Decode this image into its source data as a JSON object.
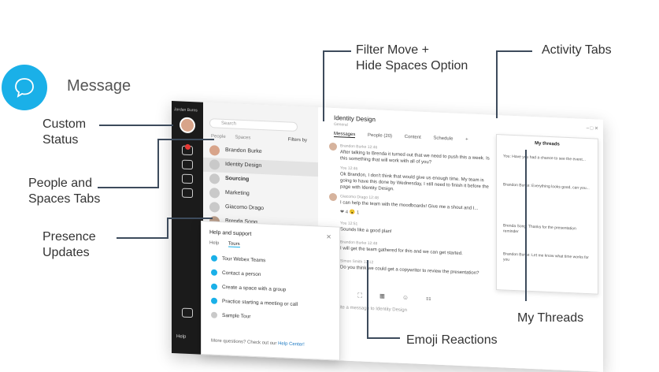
{
  "logo": {
    "label": "Message",
    "color": "#1ab0e8"
  },
  "callouts": {
    "filter": "Filter Move +\nHide Spaces Option",
    "activity_tabs": "Activity Tabs",
    "custom_status": "Custom\nStatus",
    "people_spaces": "People and\nSpaces Tabs",
    "presence": "Presence\nUpdates",
    "my_threads": "My Threads",
    "emoji": "Emoji Reactions"
  },
  "app": {
    "nav": {
      "user": "Jordan Burns",
      "help": "Help"
    },
    "search": {
      "placeholder": "Search"
    },
    "list_tabs": [
      "People",
      "Spaces"
    ],
    "filters": "Filters by",
    "spaces": [
      {
        "name": "Brandon Burke"
      },
      {
        "name": "Identity Design"
      },
      {
        "name": "Sourcing"
      },
      {
        "name": "Marketing"
      },
      {
        "name": "Giacomo Drago"
      },
      {
        "name": "Brenda Song"
      }
    ],
    "conversation": {
      "title": "Identity Design",
      "subtitle": "General",
      "tabs": [
        "Messages",
        "People (20)",
        "Content",
        "Schedule",
        "+"
      ],
      "messages": [
        {
          "who": "Brandon Burke 12:46",
          "text": "After talking to Brenda it turned out that we need to push this a week. Is this something that will work with all of you?"
        },
        {
          "who": "You 12:46",
          "text": "Ok Brandon, I don't think that would give us enough time. My team is going to have this done by Wednesday, I still need to finish it before the page with Identity Design."
        },
        {
          "who": "Giacomo Drago 12:48",
          "text": "I can help the team with the moodboards! Give me a shout and I..."
        },
        {
          "who": "You 12:51",
          "text": "Sounds like a good plan!"
        },
        {
          "who": "Brandon Burke 12:48",
          "text": "I will get the team gathered for this and we can get started."
        },
        {
          "who": "Simon Smith 13:12",
          "text": "Do you think we could get a copywriter to review the presentation?"
        }
      ],
      "reactions": "❤ 4  😮 1",
      "compose_icons": "☺ ⛶ ▦ ☺ ☷",
      "compose_placeholder": "Write a message to Identity Design"
    },
    "threads": {
      "title": "My threads",
      "items": [
        {
          "text": "You: Have you had a chance to see the event..."
        },
        {
          "text": "Brandon Burke: Everything looks good, can you..."
        },
        {
          "text": "Brenda Song: Thanks for the presentation reminder"
        },
        {
          "text": "Brandon Burke: Let me know what time works for you"
        }
      ]
    },
    "help_panel": {
      "title": "Help and support",
      "tabs": [
        "Help",
        "Tours"
      ],
      "items": [
        {
          "label": "Tour Webex Teams"
        },
        {
          "label": "Contact a person"
        },
        {
          "label": "Create a space with a group"
        },
        {
          "label": "Practice starting a meeting or call"
        },
        {
          "label": "Sample Tour"
        }
      ],
      "footer_text": "More questions? Check out our",
      "footer_link": "Help Center!"
    }
  }
}
